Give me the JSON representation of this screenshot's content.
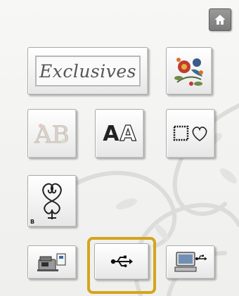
{
  "screen": {
    "background": "#f2f2f1",
    "highlight_color": "#d4a51c"
  },
  "buttons": {
    "home": {
      "icon": "home-icon"
    },
    "exclusives": {
      "label": "Exclusives"
    },
    "floral": {
      "icon": "floral-embroidery-icon"
    },
    "decorative_alphabet": {
      "label": "AB",
      "icon": "decorative-alphabet-icon"
    },
    "font": {
      "label_solid": "A",
      "label_outline": "A",
      "icon": "font-icon"
    },
    "frame": {
      "icon": "frame-heart-icon"
    },
    "bobbin_work": {
      "badge": "B",
      "icon": "bobbin-work-icon"
    },
    "machine_memory": {
      "icon": "machine-memory-icon"
    },
    "usb": {
      "icon": "usb-icon",
      "selected": true
    },
    "computer": {
      "icon": "computer-usb-icon"
    }
  }
}
